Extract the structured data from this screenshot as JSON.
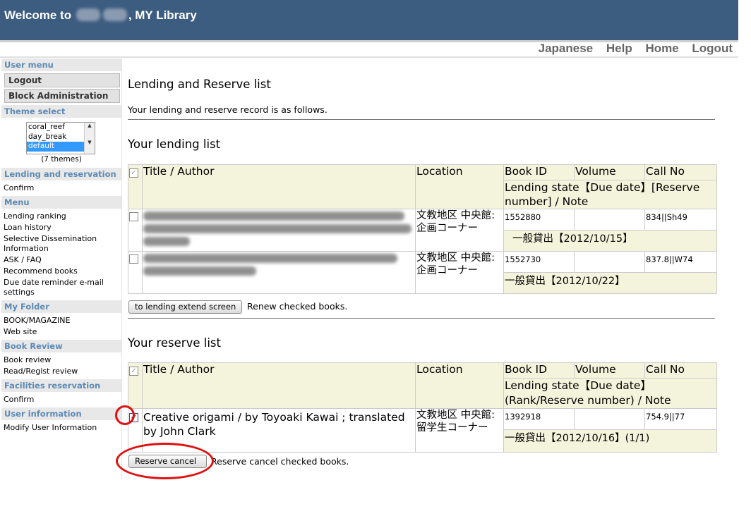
{
  "header": {
    "title_prefix": "Welcome to",
    "title_suffix": ", MY Library"
  },
  "topnav": [
    "Japanese",
    "Help",
    "Home",
    "Logout"
  ],
  "sidebar": {
    "user_menu": "User menu",
    "logout": "Logout",
    "block_admin": "Block Administration",
    "theme_select": "Theme select",
    "themes": [
      "coral_reef",
      "day_break",
      "default"
    ],
    "selected_theme": "default",
    "theme_count": "(7 themes)",
    "sections": [
      {
        "head": "Lending and reservation",
        "items": [
          "Confirm"
        ]
      },
      {
        "head": "Menu",
        "items": [
          "Lending ranking",
          "Loan history",
          "Selective Dissemination Information",
          "ASK / FAQ",
          "Recommend books",
          "Due date reminder e-mail settings"
        ]
      },
      {
        "head": "My Folder",
        "items": [
          "BOOK/MAGAZINE",
          "Web site"
        ]
      },
      {
        "head": "Book Review",
        "items": [
          "Book review",
          "Read/Regist review"
        ]
      },
      {
        "head": "Facilities reservation",
        "items": [
          "Confirm"
        ]
      },
      {
        "head": "User information",
        "items": [
          "Modify User Information"
        ]
      }
    ]
  },
  "main": {
    "page_title": "Lending and Reserve list",
    "lead": "Your lending and reserve record is as follows.",
    "lending": {
      "title": "Your lending list",
      "headers": {
        "title_author": "Title / Author",
        "location": "Location",
        "book_id": "Book ID",
        "volume": "Volume",
        "call_no": "Call No",
        "state": "Lending state【Due date】[Reserve number] / Note"
      },
      "rows": [
        {
          "location": "文教地区 中央館:企画コーナー",
          "book_id": "1552880",
          "volume": "",
          "call_no": "834||Sh49",
          "state": "一般貸出【2012/10/15】"
        },
        {
          "location": "文教地区 中央館:企画コーナー",
          "book_id": "1552730",
          "volume": "",
          "call_no": "837.8||W74",
          "state": "一般貸出【2012/10/22】"
        }
      ],
      "button": "to lending extend screen",
      "note": "Renew checked books."
    },
    "reserve": {
      "title": "Your reserve list",
      "headers": {
        "title_author": "Title / Author",
        "location": "Location",
        "book_id": "Book ID",
        "volume": "Volume",
        "call_no": "Call No",
        "state": "Lending state【Due date】 (Rank/Reserve number) / Note"
      },
      "rows": [
        {
          "title": "Creative origami / by Toyoaki Kawai ; translated by John Clark",
          "location": "文教地区 中央館:留学生コーナー",
          "book_id": "1392918",
          "volume": "",
          "call_no": "754.9||77",
          "state": "一般貸出【2012/10/16】(1/1)"
        }
      ],
      "button": "Reserve cancel",
      "note": "Reserve cancel checked books."
    }
  },
  "colors": {
    "header_bg": "#3c5c80",
    "sidebar_head": "#5d8ab5",
    "table_header_bg": "#f4f4dc",
    "highlight": "#e01010"
  }
}
